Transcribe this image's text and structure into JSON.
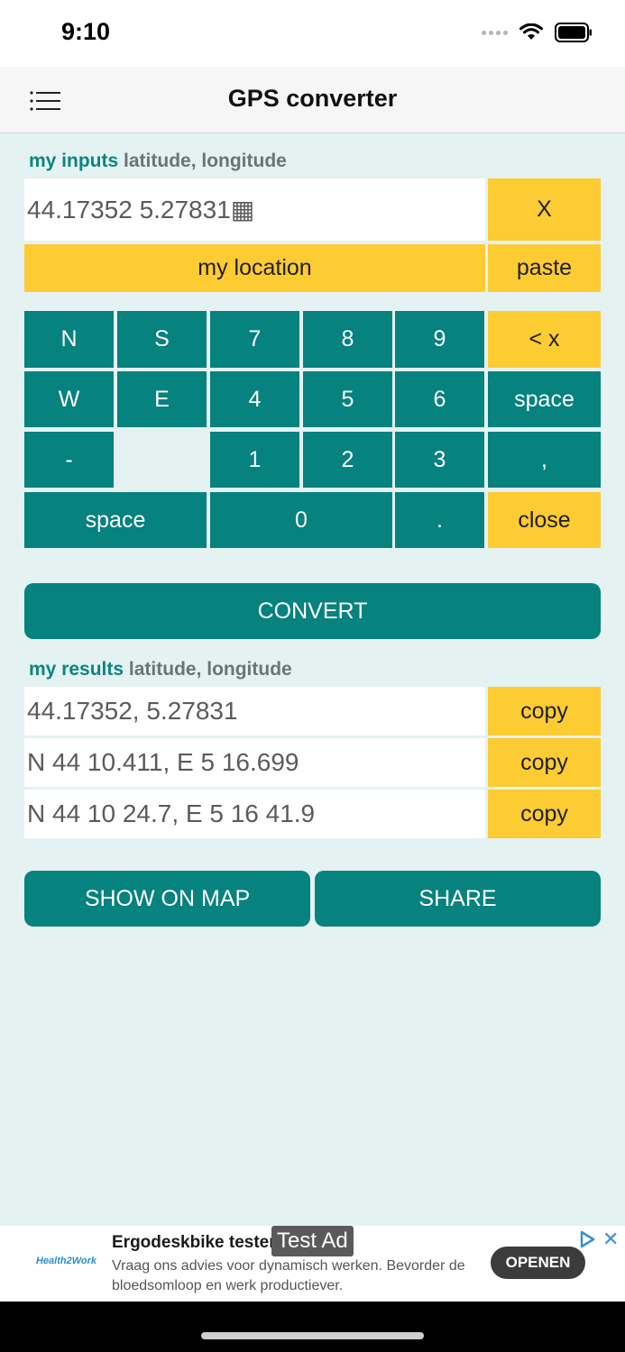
{
  "status": {
    "time": "9:10"
  },
  "header": {
    "title": "GPS converter",
    "menu_icon": "menu-list-icon"
  },
  "inputs": {
    "label_accent": "my inputs",
    "label_rest": "latitude, longitude",
    "value": "44.17352 5.27831▦",
    "clear_label": "X",
    "location_label": "my location",
    "paste_label": "paste"
  },
  "keypad": {
    "row1": [
      "N",
      "S",
      "7",
      "8",
      "9",
      "< x"
    ],
    "row2": [
      "W",
      "E",
      "4",
      "5",
      "6",
      "space"
    ],
    "row3": [
      "-",
      "",
      "1",
      "2",
      "3",
      ","
    ],
    "row4": [
      "space",
      "0",
      ".",
      "close"
    ]
  },
  "convert_label": "CONVERT",
  "results": {
    "label_accent": "my results",
    "label_rest": "latitude, longitude",
    "items": [
      {
        "value": "44.17352, 5.27831",
        "copy": "copy"
      },
      {
        "value": "N 44 10.411, E 5 16.699",
        "copy": "copy"
      },
      {
        "value": "N 44 10 24.7, E 5 16 41.9",
        "copy": "copy"
      }
    ]
  },
  "actions": {
    "map_label": "SHOW ON MAP",
    "share_label": "SHARE"
  },
  "ad": {
    "logo": "Health2Work",
    "title": "Ergodeskbike tester",
    "badge": "Test Ad",
    "body": "Vraag ons advies voor dynamisch werken. Bevorder de bloedsomloop en werk productiever.",
    "cta": "OPENEN",
    "close": "✕"
  },
  "colors": {
    "teal": "#06827f",
    "yellow": "#fdcb32",
    "background": "#e4f2f1"
  }
}
